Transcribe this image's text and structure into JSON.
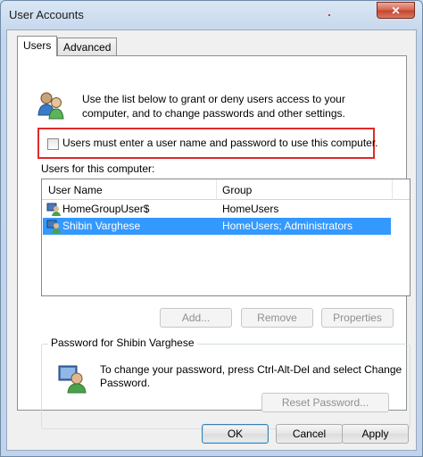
{
  "window": {
    "title": "User Accounts",
    "close_glyph": "✕"
  },
  "tabs": [
    {
      "label": "Users",
      "active": true
    },
    {
      "label": "Advanced",
      "active": false
    }
  ],
  "intro": {
    "icon": "users-icon",
    "text": "Use the list below to grant or deny users access to your computer, and to change passwords and other settings."
  },
  "require_login": {
    "label": "Users must enter a user name and password to use this computer.",
    "checked": false,
    "highlight_color": "#e02a2a"
  },
  "users_list": {
    "label": "Users for this computer:",
    "columns": [
      "User Name",
      "Group"
    ],
    "rows": [
      {
        "user": "HomeGroupUser$",
        "group": "HomeUsers",
        "selected": false
      },
      {
        "user": "Shibin Varghese",
        "group": "HomeUsers; Administrators",
        "selected": true
      }
    ]
  },
  "list_buttons": {
    "add": "Add...",
    "remove": "Remove",
    "properties": "Properties"
  },
  "password_group": {
    "legend": "Password for Shibin Varghese",
    "text": "To change your password, press Ctrl-Alt-Del and select Change Password.",
    "reset_button": "Reset Password..."
  },
  "dialog_buttons": {
    "ok": "OK",
    "cancel": "Cancel",
    "apply": "Apply"
  },
  "colors": {
    "selection": "#3399ff",
    "accent_red": "#e02a2a"
  }
}
